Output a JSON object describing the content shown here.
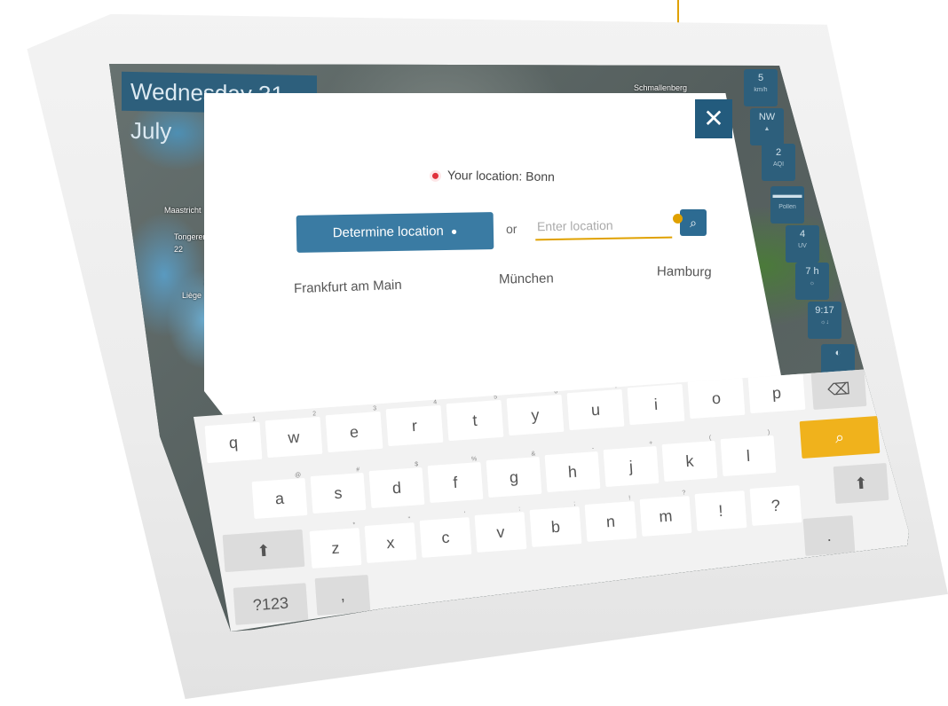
{
  "map": {
    "date": "Wednesday 31. July",
    "labels": [
      "Maastricht",
      "Tongeren",
      "22",
      "Liège",
      "22",
      "Schmallenberg"
    ]
  },
  "side_panel": {
    "items": [
      {
        "value": "5",
        "sub": "km/h"
      },
      {
        "value": "NW",
        "sub": "▲"
      },
      {
        "value": "2",
        "sub": "AQI"
      },
      {
        "value": "▬▬▬",
        "sub": "Pollen"
      },
      {
        "value": "4",
        "sub": "UV"
      },
      {
        "value": "7 h",
        "sub": "☼"
      },
      {
        "value": "9:17",
        "sub": "☼↓"
      },
      {
        "value": "◐",
        "sub": ""
      }
    ]
  },
  "dialog": {
    "close": "✕",
    "your_location": "Your location: Bonn",
    "determine_button": "Determine location",
    "pin_icon": "●",
    "or": "or",
    "input_placeholder": "Enter location",
    "search_icon": "⌕",
    "cities": [
      "Frankfurt am Main",
      "München",
      "Hamburg"
    ]
  },
  "keyboard": {
    "row1": [
      {
        "k": "q",
        "h": "1"
      },
      {
        "k": "w",
        "h": "2"
      },
      {
        "k": "e",
        "h": "3"
      },
      {
        "k": "r",
        "h": "4"
      },
      {
        "k": "t",
        "h": "5"
      },
      {
        "k": "y",
        "h": "6"
      },
      {
        "k": "u",
        "h": "7"
      },
      {
        "k": "i",
        "h": "8"
      },
      {
        "k": "o",
        "h": "9"
      },
      {
        "k": "p",
        "h": "0"
      }
    ],
    "backspace": "⌫",
    "row2": [
      {
        "k": "a",
        "h": "@"
      },
      {
        "k": "s",
        "h": "#"
      },
      {
        "k": "d",
        "h": "$"
      },
      {
        "k": "f",
        "h": "%"
      },
      {
        "k": "g",
        "h": "&"
      },
      {
        "k": "h",
        "h": "-"
      },
      {
        "k": "j",
        "h": "+"
      },
      {
        "k": "k",
        "h": "("
      },
      {
        "k": "l",
        "h": ")"
      }
    ],
    "search_key": "⌕",
    "row3": [
      {
        "k": "z",
        "h": "*"
      },
      {
        "k": "x",
        "h": "\""
      },
      {
        "k": "c",
        "h": "'"
      },
      {
        "k": "v",
        "h": ":"
      },
      {
        "k": "b",
        "h": ";"
      },
      {
        "k": "n",
        "h": "!"
      },
      {
        "k": "m",
        "h": "?"
      },
      {
        "k": "!",
        "h": ""
      },
      {
        "k": "?",
        "h": ""
      }
    ],
    "shift": "⬆",
    "period": ".",
    "symbols": "?123",
    "comma": ","
  },
  "colors": {
    "accent": "#e0a100",
    "primary": "#3a7ba3",
    "dark_primary": "#235b7d",
    "key_yellow": "#f0b21c"
  }
}
